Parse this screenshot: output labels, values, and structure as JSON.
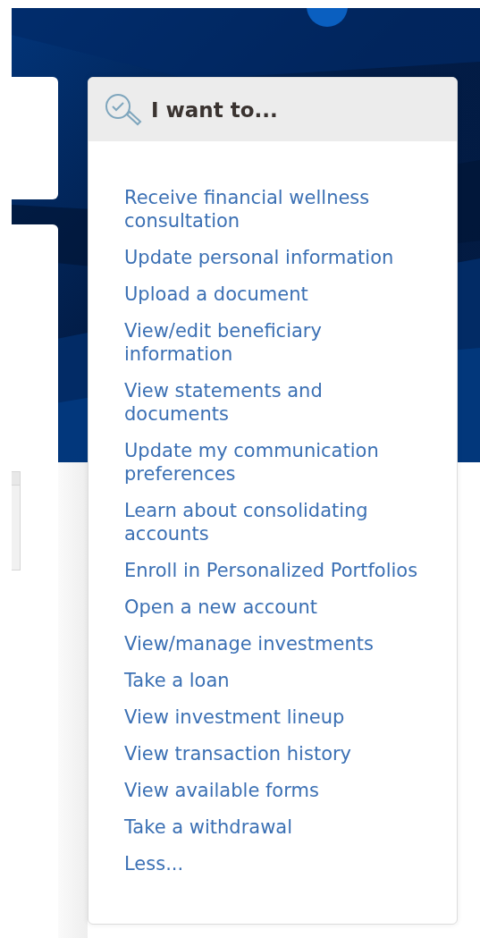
{
  "panel": {
    "title": "I want to...",
    "links": [
      {
        "label": "Receive financial wellness consultation"
      },
      {
        "label": "Update personal information"
      },
      {
        "label": "Upload a document"
      },
      {
        "label": "View/edit beneficiary information"
      },
      {
        "label": "View statements and documents"
      },
      {
        "label": "Update my communication preferences"
      },
      {
        "label": "Learn about consolidating accounts"
      },
      {
        "label": "Enroll in Personalized Portfolios"
      },
      {
        "label": "Open a new account"
      },
      {
        "label": "View/manage investments"
      },
      {
        "label": "Take a loan"
      },
      {
        "label": "View investment lineup"
      },
      {
        "label": "View transaction history"
      },
      {
        "label": "View available forms"
      },
      {
        "label": "Take a withdrawal"
      }
    ],
    "toggle": {
      "label": "Less..."
    }
  }
}
